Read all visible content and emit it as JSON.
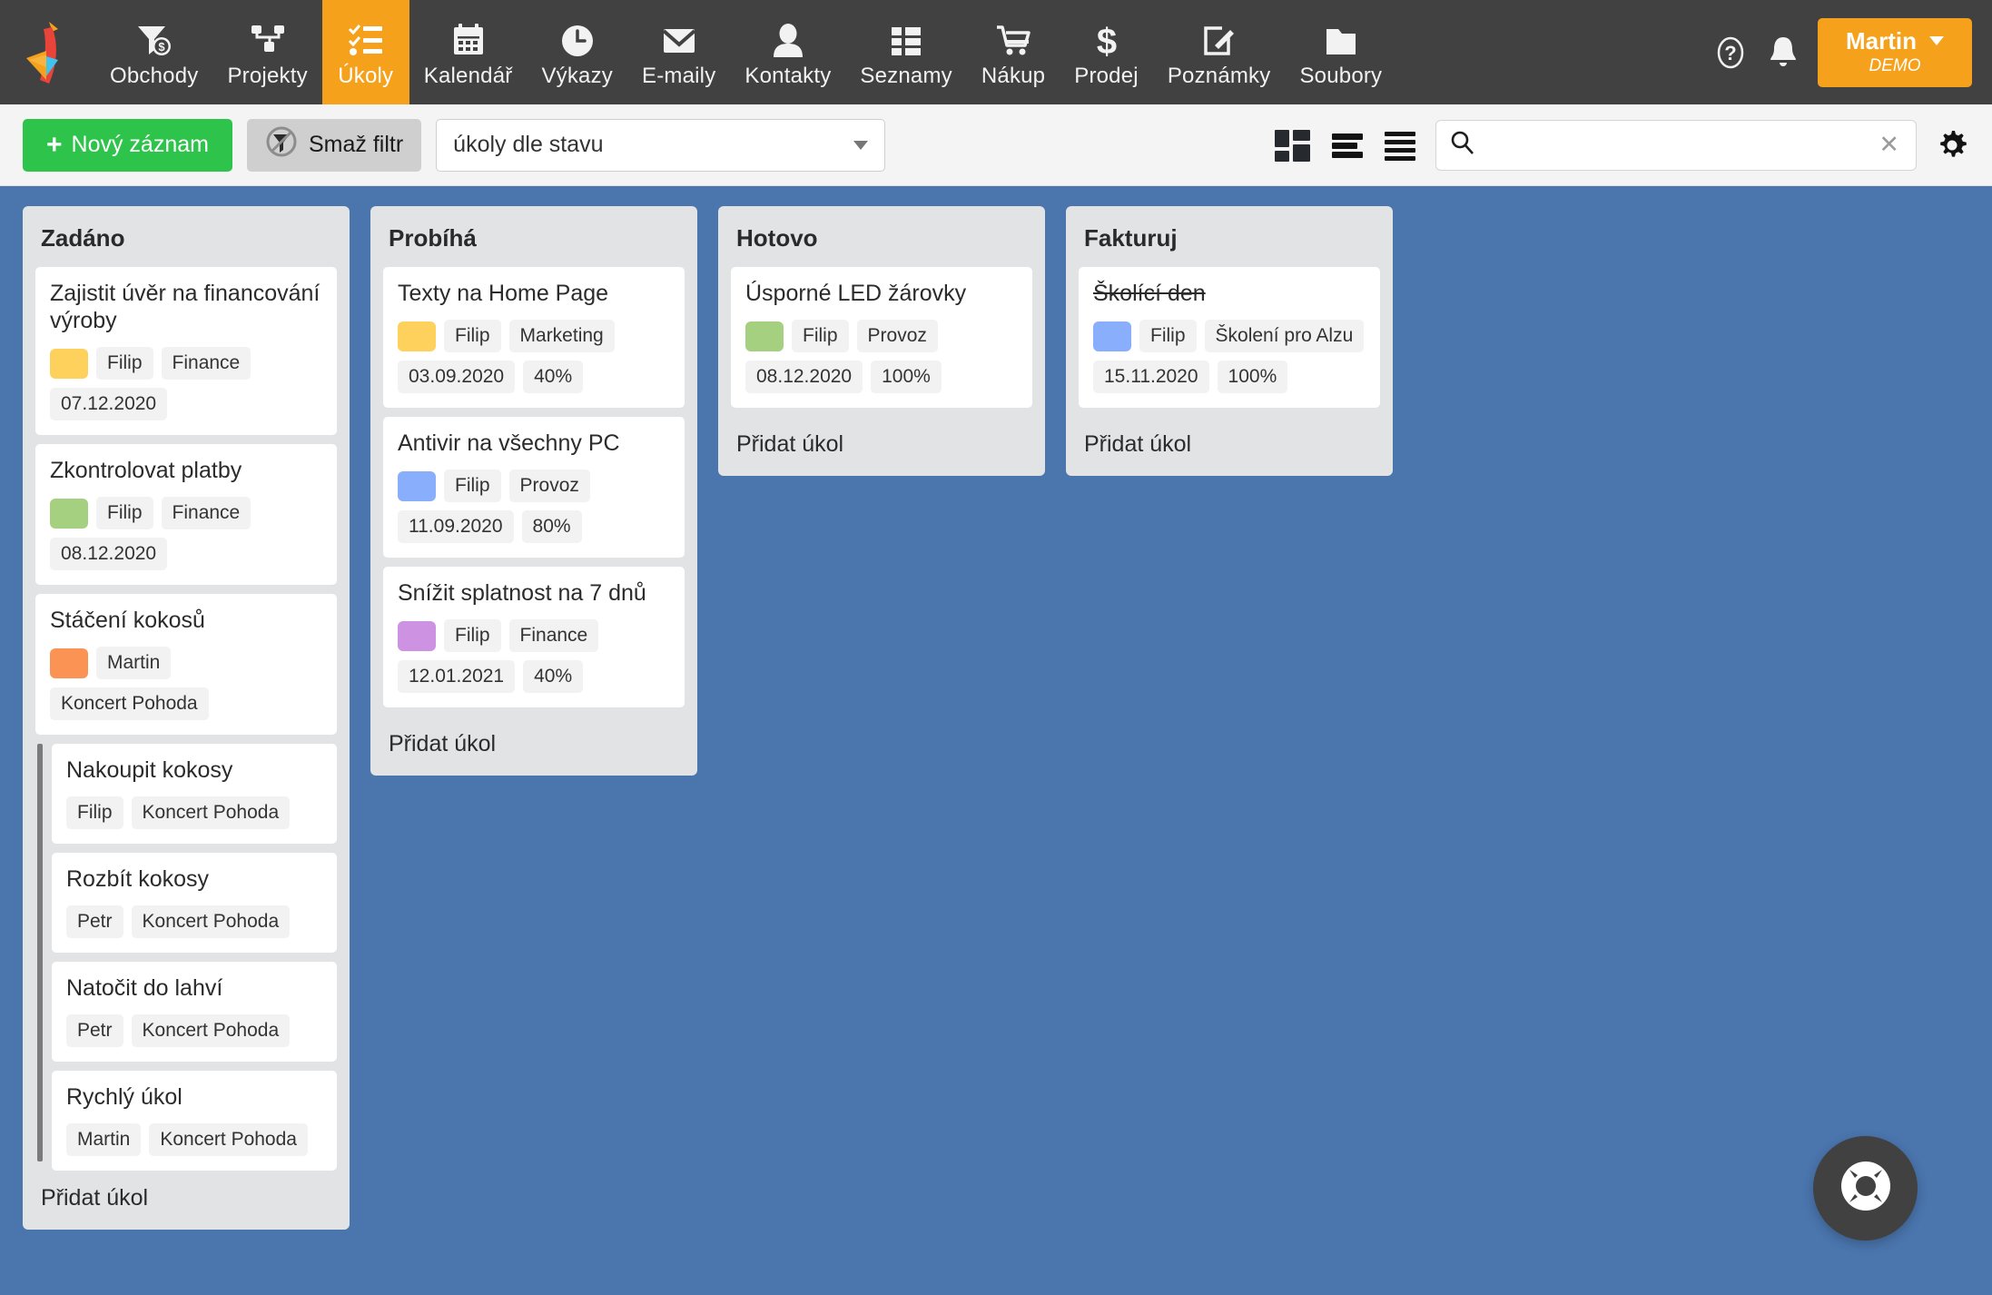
{
  "app": {
    "logo_icon": "bird-logo-icon"
  },
  "nav": {
    "items": [
      {
        "label": "Obchody",
        "icon": "funnel-dollar-icon",
        "active": false
      },
      {
        "label": "Projekty",
        "icon": "project-tree-icon",
        "active": false
      },
      {
        "label": "Úkoly",
        "icon": "checklist-icon",
        "active": true
      },
      {
        "label": "Kalendář",
        "icon": "calendar-icon",
        "active": false
      },
      {
        "label": "Výkazy",
        "icon": "clock-icon",
        "active": false
      },
      {
        "label": "E-maily",
        "icon": "envelope-icon",
        "active": false
      },
      {
        "label": "Kontakty",
        "icon": "person-icon",
        "active": false
      },
      {
        "label": "Seznamy",
        "icon": "grid-list-icon",
        "active": false
      },
      {
        "label": "Nákup",
        "icon": "shopping-cart-icon",
        "active": false
      },
      {
        "label": "Prodej",
        "icon": "dollar-sign-icon",
        "active": false
      },
      {
        "label": "Poznámky",
        "icon": "note-edit-icon",
        "active": false
      },
      {
        "label": "Soubory",
        "icon": "folder-icon",
        "active": false
      }
    ],
    "help_icon": "question-circle-icon",
    "bell_icon": "bell-icon",
    "user": {
      "name": "Martin",
      "subtitle": "DEMO"
    },
    "accent_color": "#f5a11b",
    "bar_color": "#414141"
  },
  "toolbar": {
    "new_record_label": "Nový záznam",
    "new_record_plus": "+",
    "clear_filter_label": "Smaž filtr",
    "filter_icon": "filter-off-icon",
    "view_select_value": "úkoly dle stavu",
    "views": [
      {
        "icon": "kanban-view-icon",
        "active": true
      },
      {
        "icon": "list-view-icon",
        "active": false
      },
      {
        "icon": "detail-list-view-icon",
        "active": false
      }
    ],
    "search": {
      "value": "",
      "placeholder": "",
      "icon": "search-icon",
      "clear": "✕"
    },
    "settings_icon": "gear-icon",
    "new_button_color": "#2ec44b"
  },
  "board": {
    "background_color": "#4a75ad",
    "column_color": "#e1e3e5",
    "add_task_label": "Přidat úkol",
    "columns": [
      {
        "title": "Zadáno",
        "cards": [
          {
            "title": "Zajistit úvěr na financování výroby",
            "color": "#fdd15c",
            "tags": [
              "Filip",
              "Finance",
              "07.12.2020"
            ],
            "strike": false
          },
          {
            "title": "Zkontrolovat platby",
            "color": "#a5d080",
            "tags": [
              "Filip",
              "Finance",
              "08.12.2020"
            ],
            "strike": false
          },
          {
            "title": "Stáčení kokosů",
            "color": "#fb9354",
            "tags": [
              "Martin",
              "Koncert Pohoda"
            ],
            "strike": false
          }
        ],
        "subgroup": [
          {
            "title": "Nakoupit kokosy",
            "color": null,
            "tags": [
              "Filip",
              "Koncert Pohoda"
            ],
            "strike": false
          },
          {
            "title": "Rozbít kokosy",
            "color": null,
            "tags": [
              "Petr",
              "Koncert Pohoda"
            ],
            "strike": false
          },
          {
            "title": "Natočit do lahví",
            "color": null,
            "tags": [
              "Petr",
              "Koncert Pohoda"
            ],
            "strike": false
          },
          {
            "title": "Rychlý úkol",
            "color": null,
            "tags": [
              "Martin",
              "Koncert Pohoda"
            ],
            "strike": false
          }
        ]
      },
      {
        "title": "Probíhá",
        "cards": [
          {
            "title": "Texty na Home Page",
            "color": "#fdd15c",
            "tags": [
              "Filip",
              "Marketing",
              "03.09.2020",
              "40%"
            ],
            "strike": false
          },
          {
            "title": "Antivir na všechny PC",
            "color": "#89aefb",
            "tags": [
              "Filip",
              "Provoz",
              "11.09.2020",
              "80%"
            ],
            "strike": false
          },
          {
            "title": "Snížit splatnost na 7 dnů",
            "color": "#cd92e2",
            "tags": [
              "Filip",
              "Finance",
              "12.01.2021",
              "40%"
            ],
            "strike": false
          }
        ],
        "subgroup": []
      },
      {
        "title": "Hotovo",
        "cards": [
          {
            "title": "Úsporné LED žárovky",
            "color": "#a5d080",
            "tags": [
              "Filip",
              "Provoz",
              "08.12.2020",
              "100%"
            ],
            "strike": false
          }
        ],
        "subgroup": []
      },
      {
        "title": "Fakturuj",
        "cards": [
          {
            "title": "Školící den",
            "color": "#89aefb",
            "tags": [
              "Filip",
              "Školení pro Alzu",
              "15.11.2020",
              "100%"
            ],
            "strike": true
          }
        ],
        "subgroup": []
      }
    ]
  },
  "fab": {
    "icon": "lifebuoy-help-icon"
  }
}
